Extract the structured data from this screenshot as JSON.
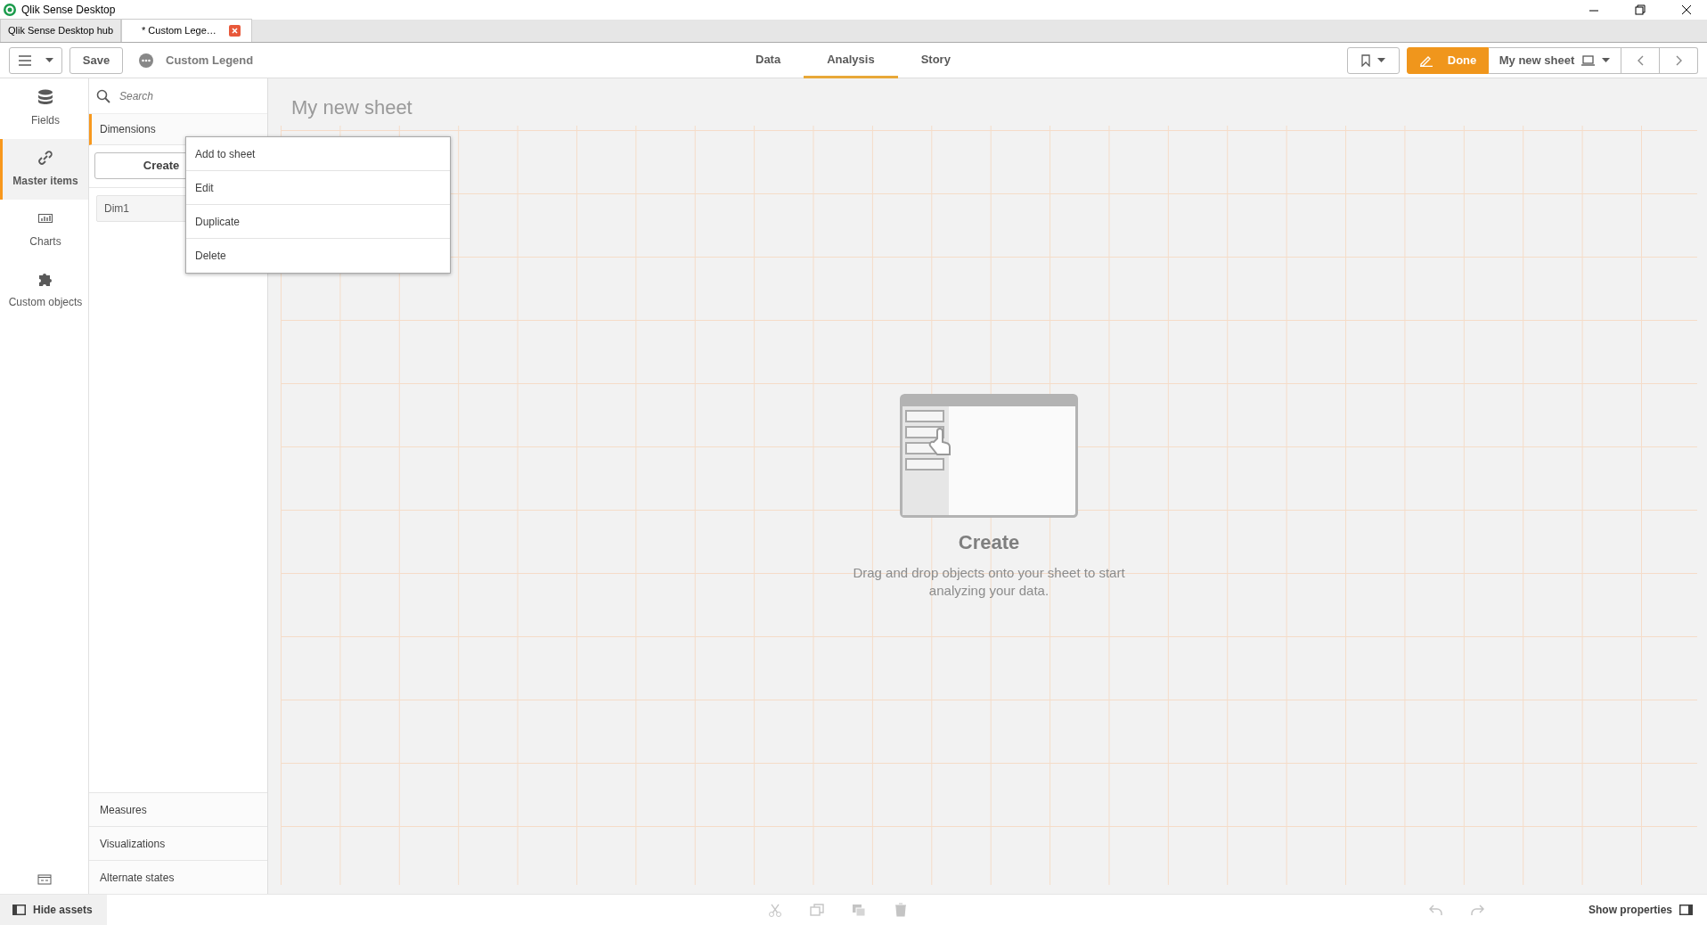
{
  "window": {
    "title": "Qlik Sense Desktop"
  },
  "browser_tabs": [
    {
      "label": "Qlik Sense Desktop hub",
      "selected": false,
      "closable": false
    },
    {
      "label": "* Custom Lege…",
      "selected": true,
      "closable": true
    }
  ],
  "toolbar": {
    "save": "Save",
    "app_name": "Custom Legend",
    "done": "Done",
    "sheet_name": "My new sheet",
    "mode_tabs": [
      {
        "label": "Data",
        "selected": false
      },
      {
        "label": "Analysis",
        "selected": true
      },
      {
        "label": "Story",
        "selected": false
      }
    ]
  },
  "nav": [
    {
      "label": "Fields",
      "kind": "database",
      "selected": false
    },
    {
      "label": "Master items",
      "kind": "link",
      "selected": true
    },
    {
      "label": "Charts",
      "kind": "chart",
      "selected": false
    },
    {
      "label": "Custom objects",
      "kind": "puzzle",
      "selected": false
    }
  ],
  "assets": {
    "search_placeholder": "Search",
    "section": "Dimensions",
    "create": "Create",
    "items": [
      "Dim1"
    ],
    "bottom_sections": [
      "Measures",
      "Visualizations",
      "Alternate states"
    ]
  },
  "context_menu": [
    "Add to sheet",
    "Edit",
    "Duplicate",
    "Delete"
  ],
  "sheet": {
    "title": "My new sheet",
    "heading": "Create",
    "hint": "Drag and drop objects onto your sheet to start analyzing your data."
  },
  "footer": {
    "hide_assets": "Hide assets",
    "show_properties": "Show properties",
    "edit_actions": [
      {
        "kind": "cut",
        "disabled": true
      },
      {
        "kind": "copy",
        "disabled": true
      },
      {
        "kind": "paste",
        "disabled": true
      },
      {
        "kind": "delete",
        "disabled": true
      }
    ],
    "history_actions": [
      {
        "kind": "undo",
        "disabled": true
      },
      {
        "kind": "redo",
        "disabled": true
      }
    ]
  }
}
